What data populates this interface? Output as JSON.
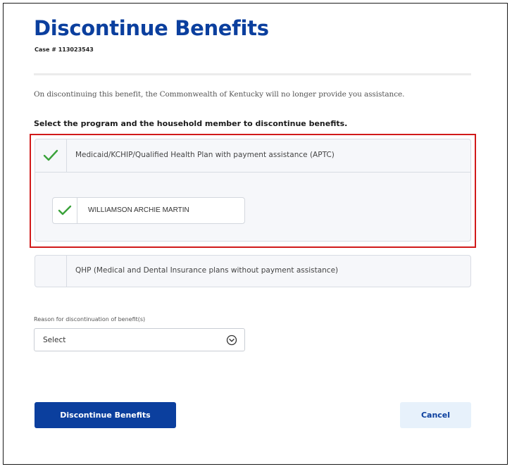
{
  "page": {
    "title": "Discontinue Benefits",
    "case_number": "Case # 113023543",
    "info_text": "On discontinuing this benefit, the Commonwealth of Kentucky will no longer provide you assistance.",
    "instruction": "Select the program and the household member to discontinue benefits."
  },
  "programs": [
    {
      "label": "Medicaid/KCHIP/Qualified Health Plan with payment assistance (APTC)",
      "checked": true,
      "members": [
        {
          "name": "WILLIAMSON ARCHIE MARTIN",
          "checked": true
        }
      ]
    },
    {
      "label": "QHP (Medical and Dental Insurance plans without payment assistance)",
      "checked": false
    }
  ],
  "reason": {
    "label": "Reason for discontinuation of benefit(s)",
    "selected": "Select"
  },
  "actions": {
    "primary_label": "Discontinue Benefits",
    "cancel_label": "Cancel"
  },
  "colors": {
    "brand_blue": "#0b3f9e",
    "check_green": "#3aa23a",
    "highlight_red": "#d11a1a",
    "cancel_bg": "#e7f1fb"
  },
  "icons": {
    "check": "check-icon",
    "select_chevron": "chevron-down-circle-icon"
  }
}
